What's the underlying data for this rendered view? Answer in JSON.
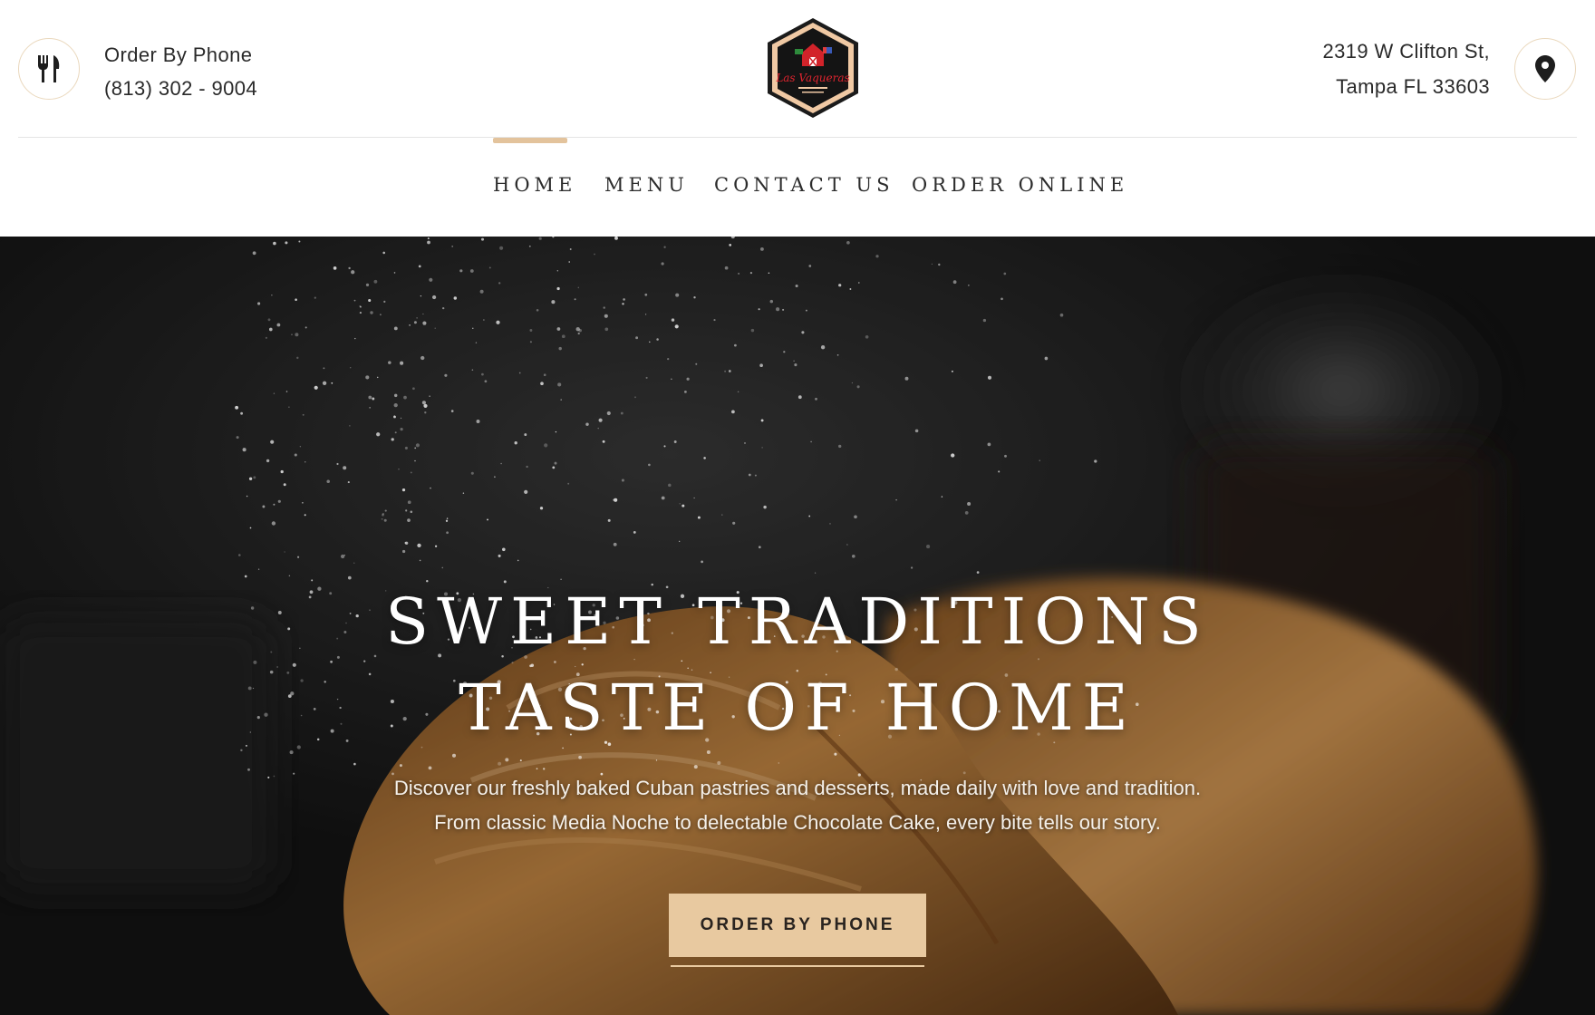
{
  "header": {
    "phone_label": "Order By Phone",
    "phone_number": "(813) 302 - 9004",
    "address_line1": "2319 W Clifton St,",
    "address_line2": "Tampa FL 33603",
    "logo_text": "Las Vaqueras",
    "phone_icon": "fork-knife-icon",
    "location_icon": "map-pin-icon"
  },
  "nav": {
    "items": [
      {
        "label": "HOME",
        "active": true
      },
      {
        "label": "MENU",
        "active": false
      },
      {
        "label": "CONTACT US",
        "active": false
      },
      {
        "label": "ORDER ONLINE",
        "active": false
      }
    ]
  },
  "hero": {
    "title_line1": "SWEET TRADITIONS",
    "title_line2": "TASTE OF HOME",
    "subtitle_line1": "Discover our freshly baked Cuban pastries and desserts, made daily with love and tradition.",
    "subtitle_line2": "From classic Media Noche to delectable Chocolate Cake, every bite tells our story.",
    "cta_label": "ORDER BY PHONE"
  },
  "colors": {
    "accent": "#e8c9a0",
    "nav_active": "#e3c39c",
    "text_dark": "#2a2a2a",
    "hero_bg": "#151515"
  }
}
